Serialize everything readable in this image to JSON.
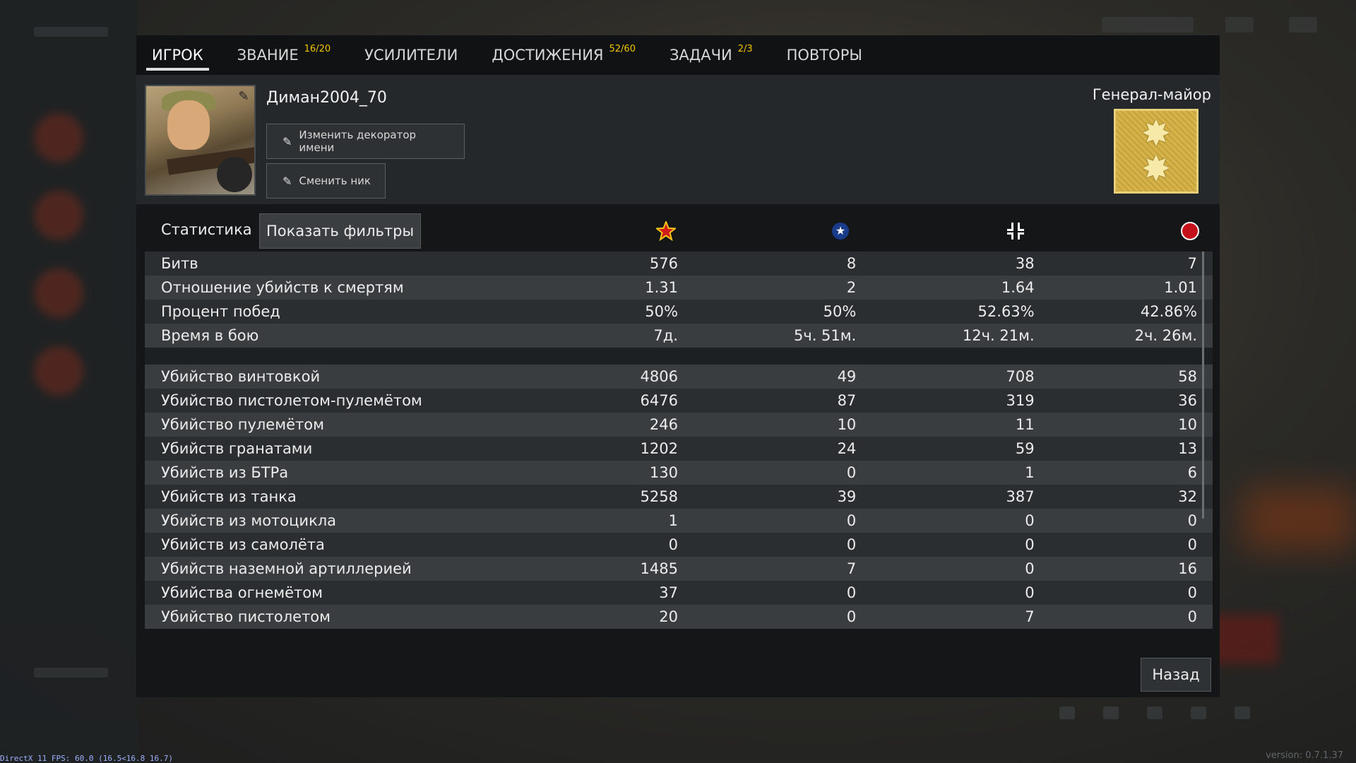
{
  "tabs": [
    {
      "label": "ИГРОК",
      "badge": ""
    },
    {
      "label": "ЗВАНИЕ",
      "badge": "16/20"
    },
    {
      "label": "УСИЛИТЕЛИ",
      "badge": ""
    },
    {
      "label": "ДОСТИЖЕНИЯ",
      "badge": "52/60"
    },
    {
      "label": "ЗАДАЧИ",
      "badge": "2/3"
    },
    {
      "label": "ПОВТОРЫ",
      "badge": ""
    }
  ],
  "active_tab": "ИГРОК",
  "profile": {
    "nickname": "Диман2004_70",
    "change_decorator_label": "Изменить декоратор имени",
    "change_nick_label": "Сменить ник",
    "rank_title": "Генерал-майор"
  },
  "stats": {
    "title": "Статистика",
    "filter_label": "Показать фильтры",
    "column_icons": [
      "red-star-icon",
      "blue-star-icon",
      "cross-icon",
      "red-circle-icon"
    ],
    "rows_general": [
      {
        "label": "Битв",
        "values": [
          "576",
          "8",
          "38",
          "7"
        ]
      },
      {
        "label": "Отношение убийств к смертям",
        "values": [
          "1.31",
          "2",
          "1.64",
          "1.01"
        ]
      },
      {
        "label": "Процент побед",
        "values": [
          "50%",
          "50%",
          "52.63%",
          "42.86%"
        ]
      },
      {
        "label": "Время в бою",
        "values": [
          "7д.",
          "5ч. 51м.",
          "12ч. 21м.",
          "2ч. 26м."
        ]
      }
    ],
    "rows_kills": [
      {
        "label": "Убийство винтовкой",
        "values": [
          "4806",
          "49",
          "708",
          "58"
        ]
      },
      {
        "label": "Убийство пистолетом-пулемётом",
        "values": [
          "6476",
          "87",
          "319",
          "36"
        ]
      },
      {
        "label": "Убийство пулемётом",
        "values": [
          "246",
          "10",
          "11",
          "10"
        ]
      },
      {
        "label": "Убийств гранатами",
        "values": [
          "1202",
          "24",
          "59",
          "13"
        ]
      },
      {
        "label": "Убийств из БТРа",
        "values": [
          "130",
          "0",
          "1",
          "6"
        ]
      },
      {
        "label": "Убийств из танка",
        "values": [
          "5258",
          "39",
          "387",
          "32"
        ]
      },
      {
        "label": "Убийств из мотоцикла",
        "values": [
          "1",
          "0",
          "0",
          "0"
        ]
      },
      {
        "label": "Убийств из самолёта",
        "values": [
          "0",
          "0",
          "0",
          "0"
        ]
      },
      {
        "label": "Убийств наземной артиллерией",
        "values": [
          "1485",
          "7",
          "0",
          "16"
        ]
      },
      {
        "label": "Убийства огнемётом",
        "values": [
          "37",
          "0",
          "0",
          "0"
        ]
      },
      {
        "label": "Убийство пистолетом",
        "values": [
          "20",
          "0",
          "7",
          "0"
        ]
      }
    ]
  },
  "back_label": "Назад",
  "fps_text": "DirectX 11 FPS: 60.0 (16.5<16.8 16.7)",
  "version_text": "version: 0.7.1.37",
  "colors": {
    "badge": "#f2c400",
    "panel": "#141617",
    "row_light": "#3a3d3f",
    "row_dark": "#2b2e30"
  }
}
